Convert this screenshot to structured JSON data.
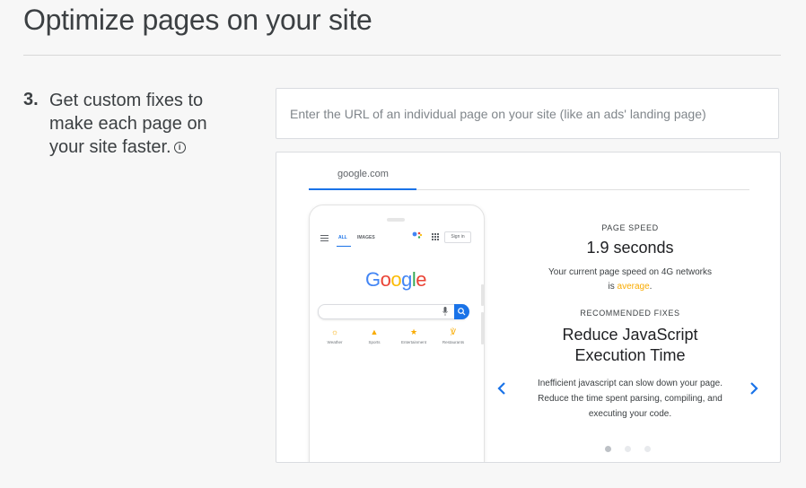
{
  "header": {
    "title": "Optimize pages on your site"
  },
  "step": {
    "number": "3.",
    "text": "Get custom fixes to make each page on your site faster.",
    "info_icon": "info-icon"
  },
  "url_input": {
    "placeholder": "Enter the URL of an individual page on your site (like an ads' landing page)",
    "value": ""
  },
  "preview": {
    "tab_label": "google.com",
    "phone": {
      "nav_all": "ALL",
      "nav_images": "IMAGES",
      "signin": "Sign in",
      "logo_letters": [
        "G",
        "o",
        "o",
        "g",
        "l",
        "e"
      ],
      "logo_colors": [
        "#4285f4",
        "#ea4335",
        "#fbbc05",
        "#4285f4",
        "#34a853",
        "#ea4335"
      ],
      "shortcuts": [
        {
          "label": "Weather",
          "icon": "sun-icon"
        },
        {
          "label": "Sports",
          "icon": "trophy-icon"
        },
        {
          "label": "Entertainment",
          "icon": "star-icon"
        },
        {
          "label": "Restaurants",
          "icon": "fork-knife-icon"
        }
      ]
    },
    "page_speed": {
      "label": "PAGE SPEED",
      "value": "1.9 seconds",
      "desc_line1": "Your current page speed on 4G networks",
      "desc_prefix": "is ",
      "rating": "average",
      "desc_suffix": "."
    },
    "fixes": {
      "label": "RECOMMENDED FIXES",
      "title_line1": "Reduce JavaScript",
      "title_line2": "Execution Time",
      "desc_line1": "Inefficient javascript can slow down your page.",
      "desc_line2": "Reduce the time spent parsing, compiling, and",
      "desc_line3": "executing your code."
    },
    "carousel": {
      "count": 3,
      "active_index": 0
    }
  },
  "colors": {
    "accent": "#1a73e8",
    "average": "#f9ab00"
  }
}
